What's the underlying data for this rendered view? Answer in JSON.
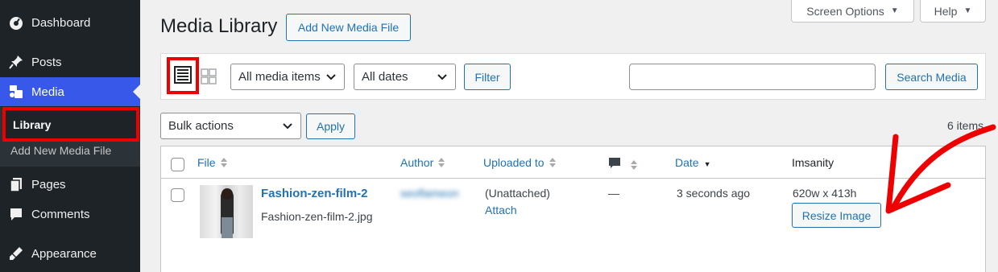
{
  "sidebar": {
    "items": [
      {
        "label": "Dashboard",
        "icon": "dashboard-icon"
      },
      {
        "label": "Posts",
        "icon": "pin-icon"
      },
      {
        "label": "Media",
        "icon": "media-icon"
      },
      {
        "label": "Pages",
        "icon": "pages-icon"
      },
      {
        "label": "Comments",
        "icon": "comment-icon"
      },
      {
        "label": "Appearance",
        "icon": "brush-icon"
      }
    ],
    "submenu": {
      "library": "Library",
      "add_new": "Add New Media File"
    }
  },
  "top": {
    "screen_options": "Screen Options",
    "help": "Help"
  },
  "header": {
    "title": "Media Library",
    "add_new": "Add New Media File"
  },
  "filters": {
    "media_type": "All media items",
    "dates": "All dates",
    "filter_button": "Filter",
    "search_value": "",
    "search_button": "Search Media"
  },
  "bulk": {
    "value": "Bulk actions",
    "apply": "Apply",
    "count": "6 items"
  },
  "table": {
    "columns": {
      "file": "File",
      "author": "Author",
      "uploaded_to": "Uploaded to",
      "date": "Date",
      "imsanity": "Imsanity"
    },
    "rows": [
      {
        "title": "Fashion-zen-film-2",
        "filename": "Fashion-zen-film-2.jpg",
        "author": "seoflameon",
        "uploaded_to": "(Unattached)",
        "attach": "Attach",
        "comments": "—",
        "date": "3 seconds ago",
        "dimensions": "620w x 413h",
        "resize": "Resize Image"
      }
    ]
  },
  "colors": {
    "accent": "#2271b1",
    "sidebar": "#1d2327",
    "active": "#3858e9",
    "highlight": "#ee0000"
  }
}
